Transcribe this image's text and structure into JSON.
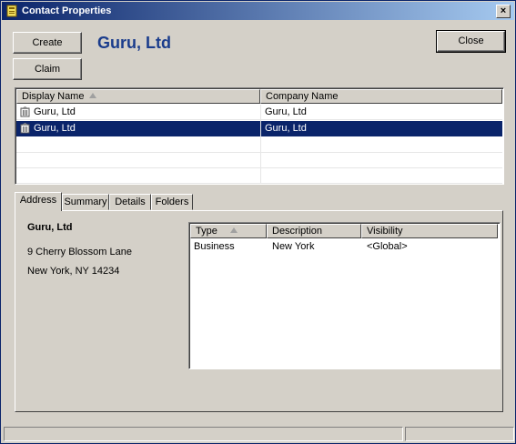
{
  "window": {
    "title": "Contact Properties",
    "close_glyph": "×"
  },
  "buttons": {
    "create": "Create",
    "claim": "Claim",
    "close": "Close"
  },
  "contact_name": "Guru, Ltd",
  "contacts_list": {
    "columns": [
      "Display Name",
      "Company Name"
    ],
    "rows": [
      {
        "display_name": "Guru, Ltd",
        "company_name": "Guru, Ltd",
        "icon": "building-icon",
        "selected": false
      },
      {
        "display_name": "Guru, Ltd",
        "company_name": "Guru, Ltd",
        "icon": "building-icon",
        "selected": true
      }
    ]
  },
  "tabs": [
    "Address",
    "Summary",
    "Details",
    "Folders"
  ],
  "active_tab": "Address",
  "address": {
    "name": "Guru, Ltd",
    "line1": "9 Cherry Blossom Lane",
    "line2": "New York, NY 14234"
  },
  "address_grid": {
    "columns": [
      "Type",
      "Description",
      "Visibility"
    ],
    "rows": [
      {
        "type": "Business",
        "description": "New York",
        "visibility": "<Global>"
      }
    ]
  },
  "colors": {
    "title_start": "#0a246a",
    "title_end": "#a6caf0",
    "heading": "#1a3c8c",
    "selection": "#0a246a"
  }
}
